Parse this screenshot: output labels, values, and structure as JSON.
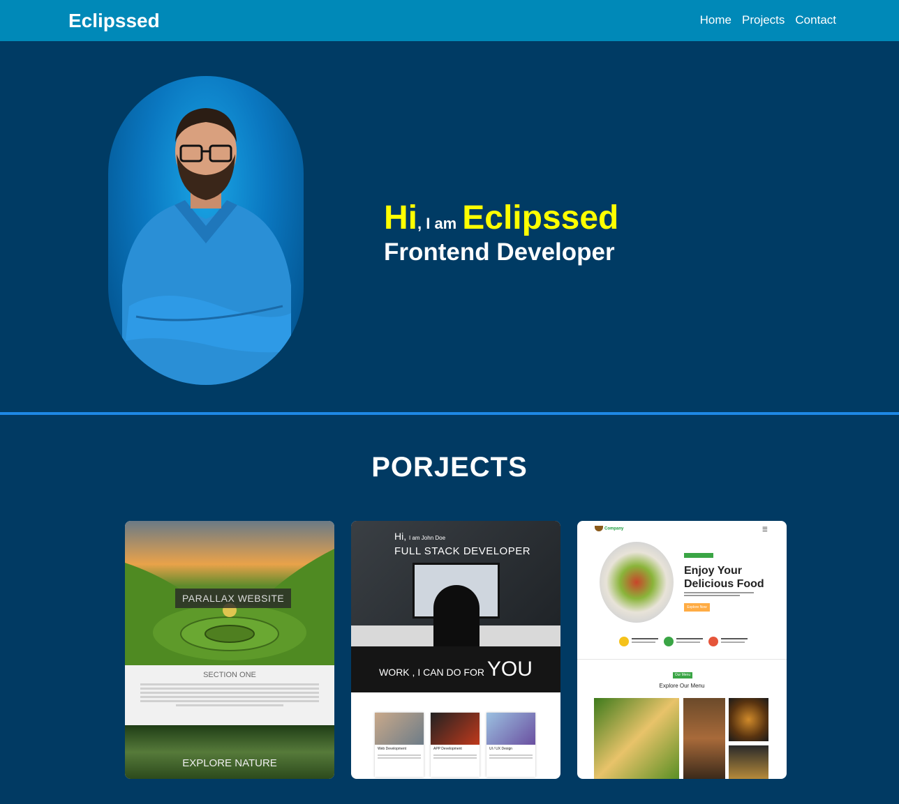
{
  "nav": {
    "brand": "Eclipssed",
    "links": [
      "Home",
      "Projects",
      "Contact"
    ]
  },
  "hero": {
    "hi": "Hi",
    "iam": ", I am",
    "name": "Eclipssed",
    "role": "Frontend Developer"
  },
  "projects": {
    "title": "PORJECTS",
    "cards": [
      {
        "label": "PARALLAX WEBSITE",
        "section": "SECTION ONE",
        "explore": "EXPLORE NATURE"
      },
      {
        "hi": "Hi,",
        "hi_small": "I am John Doe",
        "headline": "FULL STACK DEVELOPER",
        "work": "WORK , I CAN DO FOR",
        "work_big": "YOU",
        "services": [
          "Web Development",
          "APP Development",
          "UI / UX Design"
        ]
      },
      {
        "logo": "Company",
        "heading_line1": "Enjoy Your",
        "heading_line2": "Delicious Food",
        "button": "Explore Now",
        "menu_badge": "Our Menu",
        "menu_title": "Explore Our Menu",
        "features": [
          "Discount Voucher",
          "Fresh Healthy Food",
          "Fast Home Delivery"
        ]
      }
    ]
  },
  "colors": {
    "navbar": "#0089b8",
    "background": "#013a63",
    "accent_yellow": "#ffff00",
    "divider": "#1e88e5"
  }
}
